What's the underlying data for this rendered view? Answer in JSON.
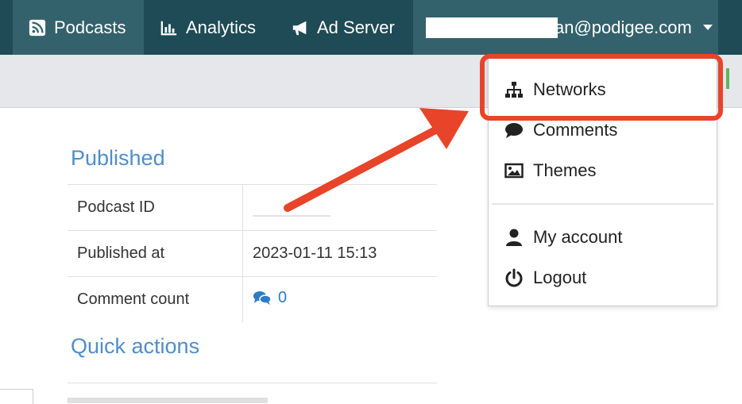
{
  "navbar": {
    "podcasts": "Podcasts",
    "analytics": "Analytics",
    "ad_server": "Ad Server",
    "user_email_suffix": "an@podigee.com"
  },
  "content": {
    "published_title": "Published",
    "rows": [
      {
        "label": "Podcast ID",
        "value": ""
      },
      {
        "label": "Published at",
        "value": "2023-01-11 15:13"
      },
      {
        "label": "Comment count",
        "value": "0"
      }
    ],
    "quick_actions_title": "Quick actions"
  },
  "dropdown": {
    "items": [
      {
        "label": "Networks",
        "icon": "sitemap-icon"
      },
      {
        "label": "Comments",
        "icon": "comment-icon"
      },
      {
        "label": "Themes",
        "icon": "image-icon"
      },
      {
        "label": "My account",
        "icon": "user-icon"
      },
      {
        "label": "Logout",
        "icon": "power-icon"
      }
    ]
  },
  "colors": {
    "navbar": "#1e4b55",
    "navbar_active": "#33626c",
    "link": "#4f8ec9",
    "annotation": "#e8442a"
  }
}
